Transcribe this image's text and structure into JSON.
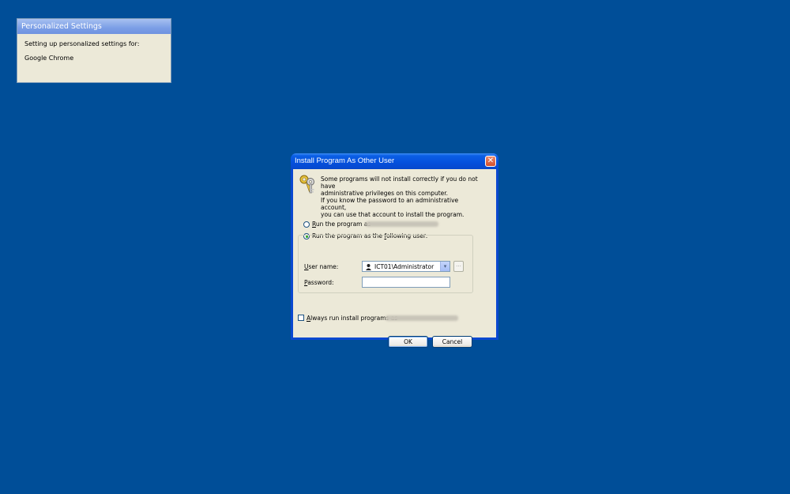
{
  "personalized": {
    "title": "Personalized Settings",
    "line1": "Setting up personalized settings for:",
    "line2": "Google Chrome"
  },
  "dialog": {
    "title": "Install Program As Other User",
    "close_icon": "close-icon",
    "message1_line1": "Some programs will not install correctly if you do not have",
    "message1_line2": "administrative privileges on this computer.",
    "message2_line1": "If you know the password to an administrative account,",
    "message2_line2": "you can use that account to install the program.",
    "option_current_prefix": "R",
    "option_current_rest": "un the program as",
    "option_other_prefix": "Run the program as the ",
    "option_other_underlined": "f",
    "option_other_rest": "ollowing user:",
    "username_label_u": "U",
    "username_label_rest": "ser name:",
    "username_value": "ICT01\\Administrator",
    "password_label_u": "P",
    "password_label_rest": "assword:",
    "password_value": "",
    "browse_label": "...",
    "always_u": "A",
    "always_rest": "lways run install programs as",
    "ok_label": "OK",
    "cancel_label": "Cancel",
    "selected_option": "following-user",
    "always_checked": false
  },
  "colors": {
    "desktop": "#004e98",
    "title_blue": "#0550dc",
    "dialog_face": "#ece9d8"
  }
}
